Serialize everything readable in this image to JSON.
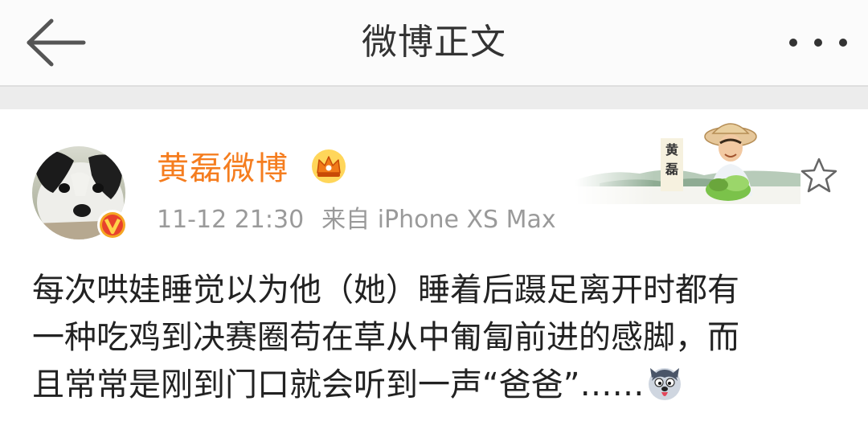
{
  "navbar": {
    "title": "微博正文",
    "back_icon": "arrow-left-icon",
    "more_icon": "more-dots-icon"
  },
  "post": {
    "username": "黄磊微博",
    "username_color": "#f57d1f",
    "crown_icon": "crown-icon",
    "verified_icon": "verified-v-icon",
    "time": "11-12 21:30",
    "source": "来自 iPhone XS Max",
    "banner_label_top": "黄",
    "banner_label_bottom": "磊",
    "star_icon": "star-outline-icon",
    "content_lines": [
      "每次哄娃睡觉以为他（她）睡着后蹑足离开时都有",
      "一种吃鸡到决赛圈苟在草从中匍匐前进的感脚，而",
      "且常常是刚到门口就会听到一声“爸爸”……"
    ],
    "emoji_icon": "husky-emoji-icon"
  }
}
